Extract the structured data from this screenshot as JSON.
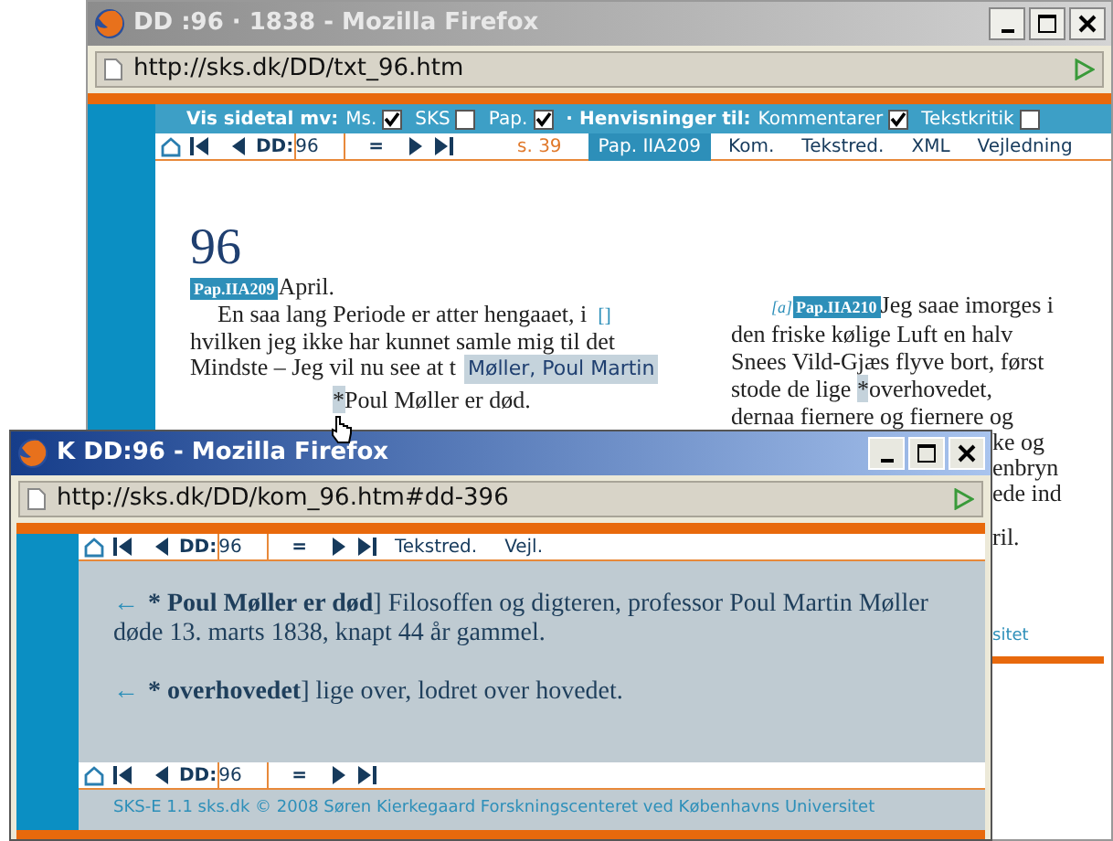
{
  "windows": [
    {
      "title": "DD :96 · 1838 - Mozilla Firefox",
      "active": false,
      "address": "http://sks.dk/DD/txt_96.htm",
      "display_options": {
        "pages_label": "Vis sidetal mv:",
        "pages": [
          {
            "label": "Ms.",
            "checked": true
          },
          {
            "label": "SKS",
            "checked": false
          },
          {
            "label": "Pap.",
            "checked": true
          }
        ],
        "refs_label": "· Henvisninger til:",
        "refs": [
          {
            "label": "Kommentarer",
            "checked": true
          },
          {
            "label": "Tekstkritik",
            "checked": false
          }
        ]
      },
      "nav": {
        "label": "DD:",
        "value": "96",
        "equals": "=",
        "page": "s. 39",
        "links": [
          {
            "label": "Pap. IIA209",
            "selected": true
          },
          {
            "label": "Kom.",
            "selected": false
          },
          {
            "label": "Tekstred.",
            "selected": false
          },
          {
            "label": "XML",
            "selected": false
          },
          {
            "label": "Vejledning",
            "selected": false
          }
        ]
      },
      "entry": {
        "number": "96",
        "badge": "Pap.IIA209",
        "heading": "April.",
        "left_lines": [
          {
            "text": "En saa lang Periode er atter hengaaet, i",
            "note": "[]"
          },
          {
            "text": "hvilken jeg ikke har kunnet samle mig til det"
          },
          {
            "text": "Mindste – Jeg vil nu see at t"
          }
        ],
        "marker": "*",
        "marked_text": "Poul Møller er død.",
        "tooltip": "Møller, Poul Martin",
        "right_note": "[a]",
        "right_badge": "Pap.IIA210",
        "right_lines": [
          "Jeg saae imorges i",
          "den friske kølige Luft en halv",
          "Snees Vild-Gjæs flyve bort, først"
        ],
        "right_marked": {
          "before": "stode de lige ",
          "marker": "*",
          "after": "overhovedet,"
        },
        "right_more": [
          "dernaa fiernere og fiernere og"
        ],
        "right_fragments": [
          "ke og",
          "enbryn",
          "ede ind"
        ],
        "right_last": "ril.",
        "footer_fragment": "sitet"
      }
    },
    {
      "title": "K DD:96 - Mozilla Firefox",
      "active": true,
      "address": "http://sks.dk/DD/kom_96.htm#dd-396",
      "nav": {
        "label": "DD:",
        "value": "96",
        "equals": "=",
        "links": [
          {
            "label": "Tekstred.",
            "selected": false
          },
          {
            "label": "Vejl.",
            "selected": false
          }
        ]
      },
      "comments": [
        {
          "arrow": "←",
          "lemma": "* Poul Møller er død",
          "text": "] Filosoffen og digteren, professor Poul Martin Møller døde 13. marts 1838, knapt 44 år gammel."
        },
        {
          "arrow": "←",
          "lemma": "* overhovedet",
          "text": "] lige over, lodret over hovedet."
        }
      ],
      "bottom_nav": {
        "label": "DD:",
        "value": "96",
        "equals": "="
      },
      "footer": "SKS-E 1.1 sks.dk © 2008 Søren Kierkegaard Forskningscenteret ved Københavns Universitet"
    }
  ]
}
